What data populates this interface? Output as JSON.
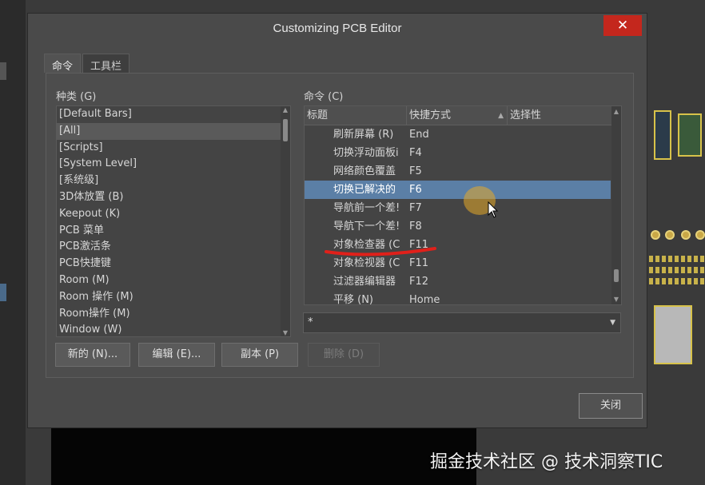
{
  "dialog": {
    "title": "Customizing PCB Editor",
    "close_glyph": "✕",
    "tabs": [
      {
        "label": "命令",
        "active": true
      },
      {
        "label": "工具栏",
        "active": false
      }
    ]
  },
  "categories": {
    "label": "种类 (G)",
    "items": [
      {
        "label": "[Default Bars]",
        "selected": false
      },
      {
        "label": "[All]",
        "selected": true
      },
      {
        "label": "[Scripts]",
        "selected": false
      },
      {
        "label": "[System Level]",
        "selected": false
      },
      {
        "label": "[系统级]",
        "selected": false
      },
      {
        "label": "3D体放置 (B)",
        "selected": false
      },
      {
        "label": "Keepout (K)",
        "selected": false
      },
      {
        "label": "PCB 菜单",
        "selected": false
      },
      {
        "label": "PCB激活条",
        "selected": false
      },
      {
        "label": "PCB快捷键",
        "selected": false
      },
      {
        "label": "Room (M)",
        "selected": false
      },
      {
        "label": "Room 操作 (M)",
        "selected": false
      },
      {
        "label": "Room操作 (M)",
        "selected": false
      },
      {
        "label": "Window (W)",
        "selected": false
      }
    ]
  },
  "commands": {
    "label": "命令 (C)",
    "columns": [
      "标题",
      "快捷方式",
      "选择性"
    ],
    "rows": [
      {
        "title": "刷新屏幕 (R)",
        "shortcut": "End",
        "selected": false
      },
      {
        "title": "切换浮动面板i",
        "shortcut": "F4",
        "selected": false
      },
      {
        "title": "网络颜色覆盖",
        "shortcut": "F5",
        "selected": false
      },
      {
        "title": "切换已解决的",
        "shortcut": "F6",
        "selected": true
      },
      {
        "title": "导航前一个差!",
        "shortcut": "F7",
        "selected": false
      },
      {
        "title": "导航下一个差!",
        "shortcut": "F8",
        "selected": false
      },
      {
        "title": "对象检查器 (C",
        "shortcut": "F11",
        "selected": false
      },
      {
        "title": "对象检视器 (C",
        "shortcut": "F11",
        "selected": false
      },
      {
        "title": "过滤器编辑器",
        "shortcut": "F12",
        "selected": false
      },
      {
        "title": "平移 (N)",
        "shortcut": "Home",
        "selected": false
      }
    ],
    "filter_value": "*"
  },
  "buttons": {
    "new": "新的 (N)...",
    "edit": "编辑 (E)...",
    "copy": "副本 (P)",
    "delete": "删除 (D)",
    "close": "关闭"
  },
  "watermark": "掘金技术社区 @ 技术洞察TIC",
  "colors": {
    "selection": "#5b7fa6",
    "close_button": "#c4271d",
    "annotation_underline": "#e0201a",
    "cursor_halo": "#e6aa28"
  }
}
